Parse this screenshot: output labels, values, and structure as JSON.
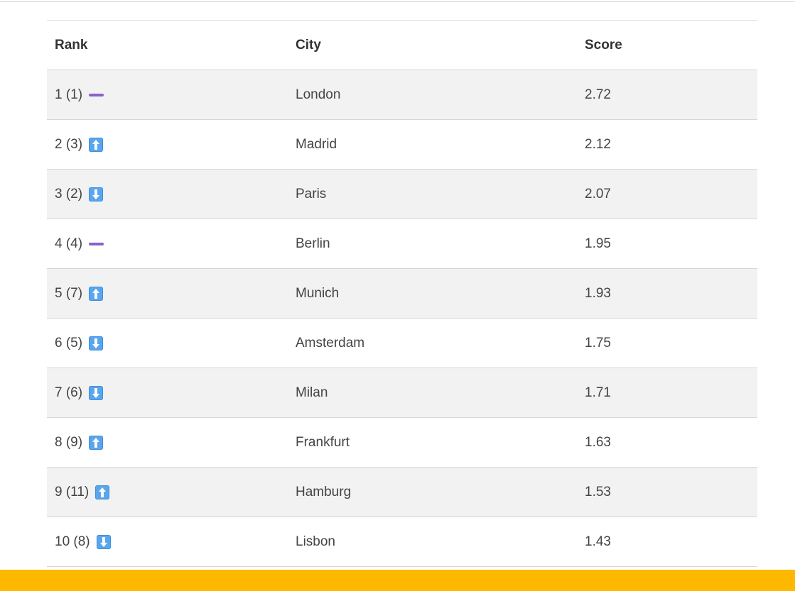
{
  "table": {
    "headers": {
      "rank": "Rank",
      "city": "City",
      "score": "Score"
    },
    "rows": [
      {
        "rank": "1 (1)",
        "trend": "same",
        "trend_icon": "dash-icon",
        "city": "London",
        "score": "2.72"
      },
      {
        "rank": "2 (3)",
        "trend": "up",
        "trend_icon": "up-arrow-icon",
        "city": "Madrid",
        "score": "2.12"
      },
      {
        "rank": "3 (2)",
        "trend": "down",
        "trend_icon": "down-arrow-icon",
        "city": "Paris",
        "score": "2.07"
      },
      {
        "rank": "4 (4)",
        "trend": "same",
        "trend_icon": "dash-icon",
        "city": "Berlin",
        "score": "1.95"
      },
      {
        "rank": "5 (7)",
        "trend": "up",
        "trend_icon": "up-arrow-icon",
        "city": "Munich",
        "score": "1.93"
      },
      {
        "rank": "6 (5)",
        "trend": "down",
        "trend_icon": "down-arrow-icon",
        "city": "Amsterdam",
        "score": "1.75"
      },
      {
        "rank": "7 (6)",
        "trend": "down",
        "trend_icon": "down-arrow-icon",
        "city": "Milan",
        "score": "1.71"
      },
      {
        "rank": "8 (9)",
        "trend": "up",
        "trend_icon": "up-arrow-icon",
        "city": "Frankfurt",
        "score": "1.63"
      },
      {
        "rank": "9 (11)",
        "trend": "up",
        "trend_icon": "up-arrow-icon",
        "city": "Hamburg",
        "score": "1.53"
      },
      {
        "rank": "10 (8)",
        "trend": "down",
        "trend_icon": "down-arrow-icon",
        "city": "Lisbon",
        "score": "1.43"
      }
    ]
  },
  "colors": {
    "footer_bar": "#ffb800",
    "alt_row": "#f2f2f2",
    "trend_same": "#8a63c9",
    "trend_arrow": "#5aa6ee"
  }
}
